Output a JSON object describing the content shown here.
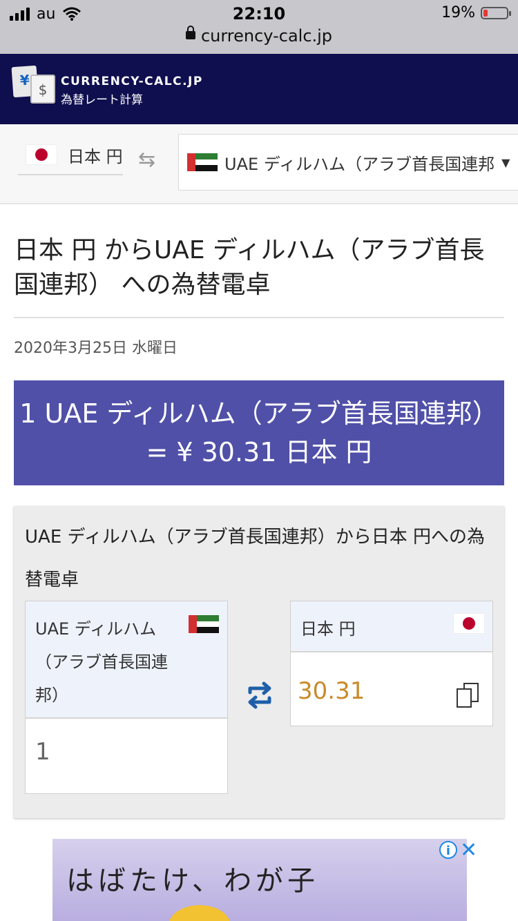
{
  "status_bar": {
    "carrier": "au",
    "time": "22:10",
    "battery_pct": "19%",
    "battery_level": 0.19,
    "url": "currency-calc.jp"
  },
  "header": {
    "brand": "CURRENCY-CALC.JP",
    "subtitle": "為替レート計算",
    "logo_yen": "¥",
    "logo_dollar": "$"
  },
  "selector": {
    "from": "日本 円",
    "to": "UAE ディルハム（アラブ首長国連邦",
    "swap_icon": "⇆"
  },
  "page": {
    "title": "日本 円 からUAE ディルハム（アラブ首長国連邦） への為替電卓",
    "date": "2020年3月25日 水曜日",
    "rate_text": "1 UAE ディルハム（アラブ首長国連邦） = ¥ 30.31 日本 円"
  },
  "calculator": {
    "title": "UAE ディルハム（アラブ首長国連邦）から日本 円への為替電卓",
    "from_label": "UAE ディルハム（アラブ首長国連邦）",
    "from_value": "1",
    "to_label": "日本 円",
    "to_value": "30.31"
  },
  "ad": {
    "text": "はばたけ、わが子",
    "info": "i",
    "close": "✕"
  },
  "colors": {
    "header_bg": "#0f0f4f",
    "rate_bg": "#5050a8",
    "result_text": "#c98a2a",
    "swap_icon": "#1e5fa8"
  }
}
